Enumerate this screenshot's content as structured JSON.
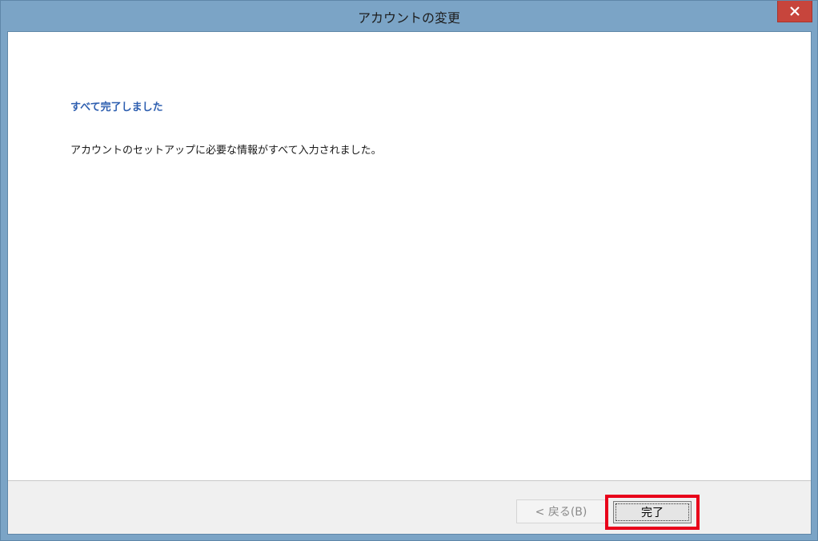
{
  "window": {
    "title": "アカウントの変更",
    "close_icon": "close-icon"
  },
  "main": {
    "heading": "すべて完了しました",
    "message": "アカウントのセットアップに必要な情報がすべて入力されました。"
  },
  "footer": {
    "back_label": "< 戻る(B)",
    "finish_label": "完了",
    "back_enabled": false
  },
  "colors": {
    "title_bar": "#7ba4c6",
    "close_button": "#c7453c",
    "heading": "#2e5fb0",
    "highlight": "#e8001a"
  }
}
